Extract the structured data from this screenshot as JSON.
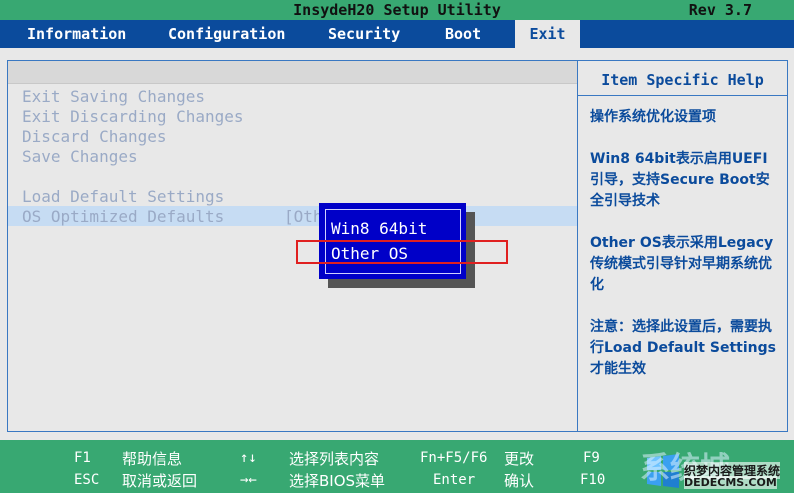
{
  "header": {
    "title": "InsydeH20 Setup Utility",
    "revision": "Rev 3.7"
  },
  "tabs": [
    "Information",
    "Configuration",
    "Security",
    "Boot",
    "Exit"
  ],
  "active_tab": "Exit",
  "menu": {
    "items": [
      "Exit Saving Changes",
      "Exit Discarding Changes",
      "Discard Changes",
      "Save Changes",
      "Load Default Settings",
      "OS Optimized Defaults"
    ],
    "selected_value": "[Othe"
  },
  "popup": {
    "options": [
      "Win8 64bit",
      "Other OS"
    ],
    "highlighted": "Other OS"
  },
  "help": {
    "title": "Item Specific Help",
    "paragraphs": [
      "操作系统优化设置项",
      "Win8 64bit表示启用UEFI引导，支持Secure Boot安全引导技术",
      "Other OS表示采用Legacy传统模式引导针对早期系统优化",
      "注意：选择此设置后，需要执行Load Default Settings才能生效"
    ]
  },
  "footer": {
    "row1": [
      {
        "key": "F1",
        "desc": "帮助信息"
      },
      {
        "key": "↑↓",
        "desc": "选择列表内容"
      },
      {
        "key": "Fn+F5/F6",
        "desc": "更改"
      },
      {
        "key": "F9",
        "desc": ""
      }
    ],
    "row2": [
      {
        "key": "ESC",
        "desc": "取消或返回"
      },
      {
        "key": "→←",
        "desc": "选择BIOS菜单"
      },
      {
        "key": "Enter",
        "desc": "确认"
      },
      {
        "key": "F10",
        "desc": ""
      }
    ]
  },
  "watermark": {
    "big": "系统城",
    "line1": "织梦内容管理系统",
    "line2": "DEDECMS.COM"
  },
  "colors": {
    "green": "#38a872",
    "blue": "#0b4b9c",
    "popup_blue": "#0000c8",
    "red": "#e02020"
  }
}
